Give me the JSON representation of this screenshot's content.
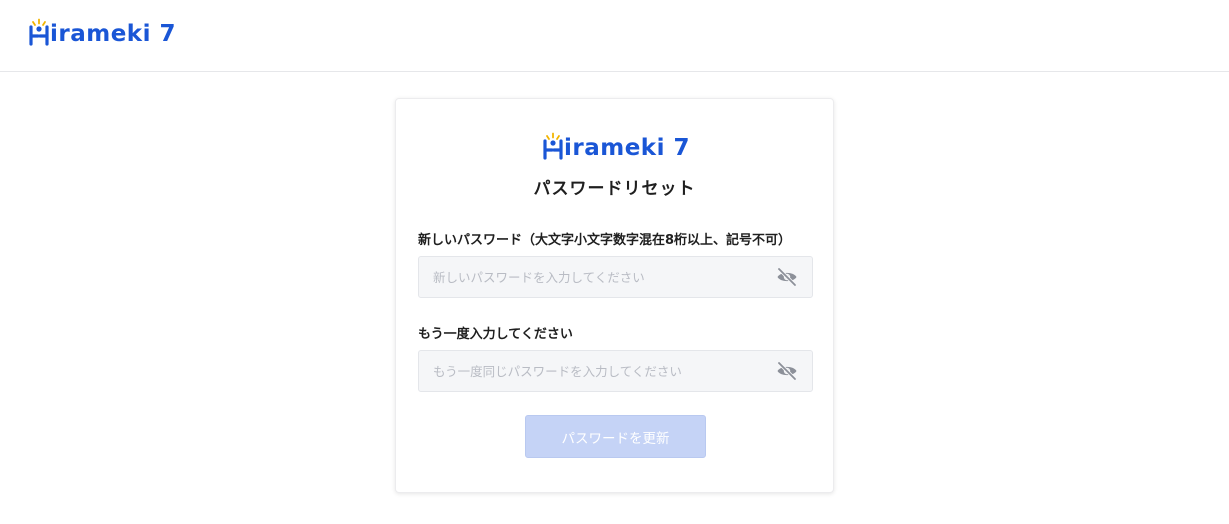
{
  "header": {
    "brand": {
      "text": "irameki 7",
      "icon": "hirameki-logo-icon",
      "color": "#1a56d6",
      "accent": "#f2b400"
    }
  },
  "card": {
    "brand": {
      "text": "irameki 7",
      "icon": "hirameki-logo-icon"
    },
    "title": "パスワードリセット",
    "new_password": {
      "label": "新しいパスワード（大文字小文字数字混在8桁以上、記号不可）",
      "placeholder": "新しいパスワードを入力してください",
      "value": "",
      "toggle_icon": "eye-slash-icon"
    },
    "confirm_password": {
      "label": "もう一度入力してください",
      "placeholder": "もう一度同じパスワードを入力してください",
      "value": "",
      "toggle_icon": "eye-slash-icon"
    },
    "submit_label": "パスワードを更新",
    "submit_color": "#c5d3f6"
  }
}
